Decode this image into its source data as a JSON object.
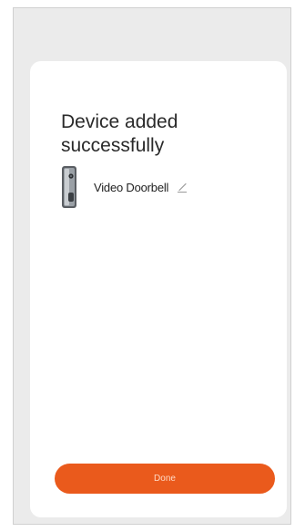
{
  "dialog": {
    "title": "Device added successfully",
    "device_name": "Video Doorbell",
    "done_label": "Done"
  },
  "icons": {
    "device": "video-doorbell-icon",
    "edit": "pencil-edit-icon"
  },
  "colors": {
    "accent": "#ea5a1c",
    "overlay": "#ebebeb",
    "card": "#ffffff"
  }
}
